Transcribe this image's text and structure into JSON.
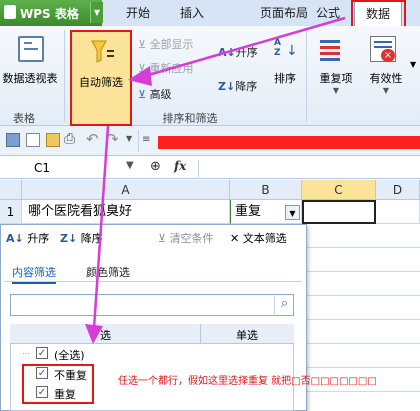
{
  "app": {
    "title": "WPS 表格"
  },
  "tabs": [
    {
      "label": "开始"
    },
    {
      "label": "插入"
    },
    {
      "label": "页面布局"
    },
    {
      "label": "公式"
    },
    {
      "label": "数据",
      "active": true
    }
  ],
  "ribbon": {
    "pivot_label": "数据透视表",
    "table_group_label": "表格",
    "autofilter_label": "自动筛选",
    "show_all_label": "全部显示",
    "reapply_label": "重新应用",
    "advanced_label": "高级",
    "sort_asc_label": "升序",
    "sort_desc_label": "降序",
    "sort_label": "排序",
    "sort_filter_group_label": "排序和筛选",
    "duplicates_label": "重复项",
    "validity_label": "有效性"
  },
  "formula_bar": {
    "name_box": "C1",
    "fx": "fx"
  },
  "grid": {
    "columns": [
      "A",
      "B",
      "C",
      "D"
    ],
    "row_number": "1",
    "cells": {
      "A1": "哪个医院看狐臭好",
      "B1": "重复"
    }
  },
  "filter_panel": {
    "sort_asc": "升序",
    "sort_desc": "降序",
    "clear": "清空条件",
    "text_filter": "文本筛选",
    "tab_content": "内容筛选",
    "tab_color": "颜色筛选",
    "list_header_left": "选",
    "list_header_right": "单选",
    "items": [
      {
        "label": "(全选)",
        "checked": true
      },
      {
        "label": "不重复",
        "checked": true
      },
      {
        "label": "重复",
        "checked": true
      }
    ],
    "annotation": "任选一个都行，假如这里选择重复 就把□否□□□□□□□"
  },
  "colors": {
    "accent_red": "#e01818",
    "highlight_yellow": "#fbe49a",
    "annotation_magenta": "#d63cd6",
    "formula_red": "#ff2020"
  }
}
